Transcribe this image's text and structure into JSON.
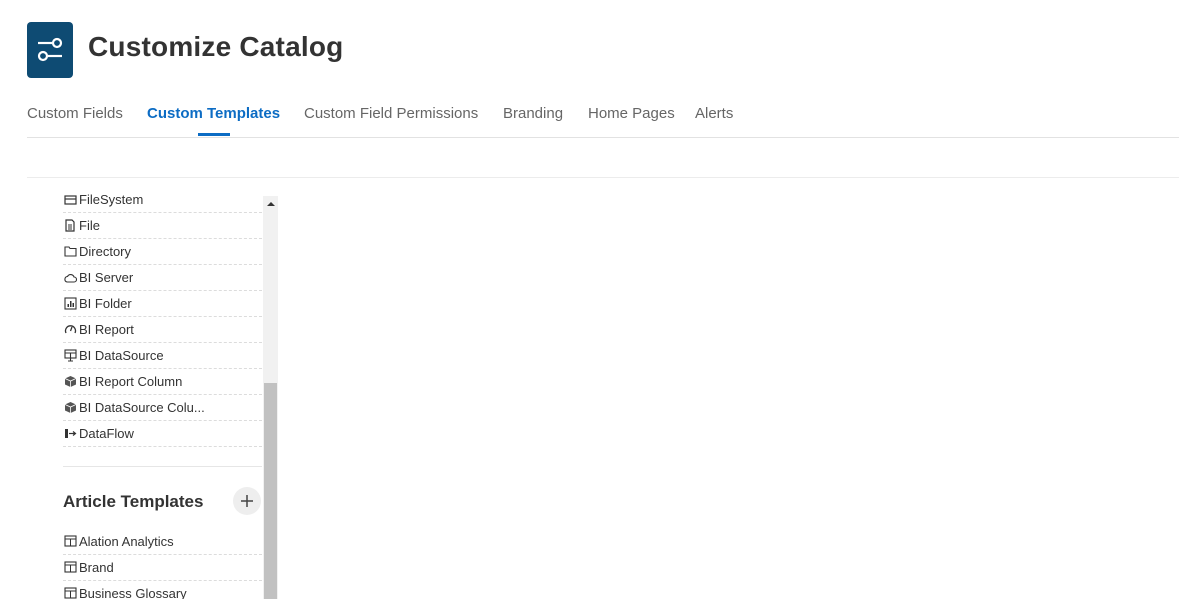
{
  "header": {
    "title": "Customize Catalog",
    "icon": "sliders-icon",
    "icon_bg": "#0e4b73"
  },
  "tabs": [
    {
      "label": "Custom Fields",
      "active": false
    },
    {
      "label": "Custom Templates",
      "active": true
    },
    {
      "label": "Custom Field Permissions",
      "active": false
    },
    {
      "label": "Branding",
      "active": false
    },
    {
      "label": "Home Pages",
      "active": false
    },
    {
      "label": "Alerts",
      "active": false
    }
  ],
  "accent_color": "#0c6cc4",
  "object_templates": [
    {
      "label": "FileSystem",
      "icon": "filesystem-icon"
    },
    {
      "label": "File",
      "icon": "file-icon"
    },
    {
      "label": "Directory",
      "icon": "folder-icon"
    },
    {
      "label": "BI Server",
      "icon": "cloud-icon"
    },
    {
      "label": "BI Folder",
      "icon": "bi-folder-icon"
    },
    {
      "label": "BI Report",
      "icon": "gauge-icon"
    },
    {
      "label": "BI DataSource",
      "icon": "datasource-icon"
    },
    {
      "label": "BI Report Column",
      "icon": "cube-icon"
    },
    {
      "label": "BI DataSource Colu...",
      "icon": "cube-icon"
    },
    {
      "label": "DataFlow",
      "icon": "dataflow-icon"
    }
  ],
  "article_section": {
    "title": "Article Templates",
    "add_icon": "plus-icon"
  },
  "article_templates": [
    {
      "label": "Alation Analytics",
      "icon": "table-icon"
    },
    {
      "label": "Brand",
      "icon": "table-icon"
    },
    {
      "label": "Business Glossary",
      "icon": "table-icon"
    }
  ]
}
